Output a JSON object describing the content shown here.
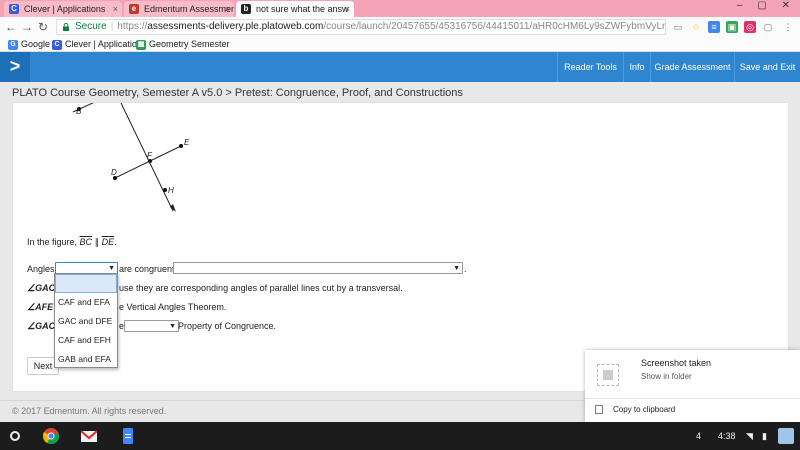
{
  "browser": {
    "tabs": [
      {
        "title": "Clever | Applications",
        "favicon": "C",
        "color": "#3b5bdb"
      },
      {
        "title": "Edmentum Assessment",
        "favicon": "e",
        "color": "#c0392b"
      },
      {
        "title": "not sure what the answ",
        "favicon": "b",
        "color": "#222222"
      }
    ],
    "tab_close": "×",
    "window_controls": "– ▢ ✕",
    "back": "←",
    "forward": "→",
    "reload": "↻",
    "secure_label": "Secure",
    "url_scheme": "https://",
    "url_host": "assessments-delivery.ple.platoweb.com",
    "url_path": "/course/launch/20457655/45316756/44415011/aHR0cHM6Ly9sZWFybmVyLnBsZS5wbGF0b3dlYi...",
    "bookmarks": [
      {
        "label": "Google",
        "icon": "G",
        "color": "#4285f4"
      },
      {
        "label": "Clever | Applications",
        "icon": "C",
        "color": "#3b5bdb"
      },
      {
        "label": "Geometry Semester",
        "icon": "▦",
        "color": "#2e9d5b"
      }
    ]
  },
  "app": {
    "menu_icon": ">",
    "nav": [
      "Reader Tools",
      "Info",
      "Grade Assessment",
      "Save and Exit"
    ],
    "course_title": "PLATO Course Geometry, Semester A v5.0 > Pretest: Congruence, Proof, and Constructions",
    "header_color": "#2f86d0"
  },
  "figure": {
    "points": [
      "B",
      "E",
      "F",
      "D",
      "H"
    ]
  },
  "question": {
    "intro_prefix": "In the figure, ",
    "seg1": "BC",
    "parallel": " ∥ ",
    "seg2": "DE",
    "intro_suffix": ".",
    "row1_label": "Angles",
    "row1_mid": "are congruent",
    "row1_end": ".",
    "row2_angle": "∠GAC",
    "row2_text": "use they are corresponding angles of parallel lines cut by a transversal.",
    "row3_angle": "∠AFE",
    "row3_text": "e Vertical Angles Theorem.",
    "row4_angle": "∠GAC",
    "row4_mid": "e",
    "row4_end": "Property of Congruence.",
    "dropdown_arrow": "▼",
    "dropdown_options": [
      "",
      "CAF and EFA",
      "GAC and DFE",
      "CAF and EFH",
      "GAB and EFA"
    ]
  },
  "buttons": {
    "next": "Next"
  },
  "footer": {
    "copyright": "© 2017 Edmentum. All rights reserved."
  },
  "notification": {
    "title": "Screenshot taken",
    "subtitle": "Show in folder",
    "action": "Copy to clipboard"
  },
  "shelf": {
    "badge": "4",
    "time": "4:38"
  }
}
